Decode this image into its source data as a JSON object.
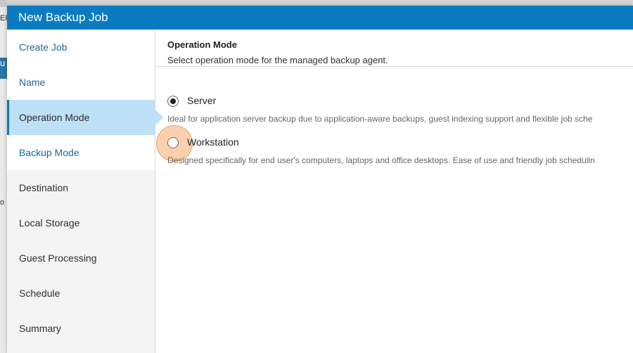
{
  "background": {
    "top_fragment": "ER",
    "blue_fragment": "u",
    "row_fragment": "o"
  },
  "dialog": {
    "title": "New Backup Job"
  },
  "steps": [
    {
      "label": "Create Job",
      "state": "done"
    },
    {
      "label": "Name",
      "state": "done"
    },
    {
      "label": "Operation Mode",
      "state": "active"
    },
    {
      "label": "Backup Mode",
      "state": "done"
    },
    {
      "label": "Destination",
      "state": "pending"
    },
    {
      "label": "Local Storage",
      "state": "pending"
    },
    {
      "label": "Guest Processing",
      "state": "pending"
    },
    {
      "label": "Schedule",
      "state": "pending"
    },
    {
      "label": "Summary",
      "state": "pending"
    }
  ],
  "content": {
    "title": "Operation Mode",
    "subtitle": "Select operation mode for the managed backup agent.",
    "options": [
      {
        "label": "Server",
        "checked": true,
        "description": "Ideal for application server backup due to application-aware backups, guest indexing support and flexible job sche"
      },
      {
        "label": "Workstation",
        "checked": false,
        "description": "Designed specifically for end user's computers, laptops and office desktops. Ease of use and friendly job schedulin"
      }
    ]
  },
  "colors": {
    "title_bar": "#0a7bc1",
    "active_step": "#bfe1f7",
    "done_step_text": "#1c6a9b",
    "click_indicator": "#f5aa6e"
  }
}
